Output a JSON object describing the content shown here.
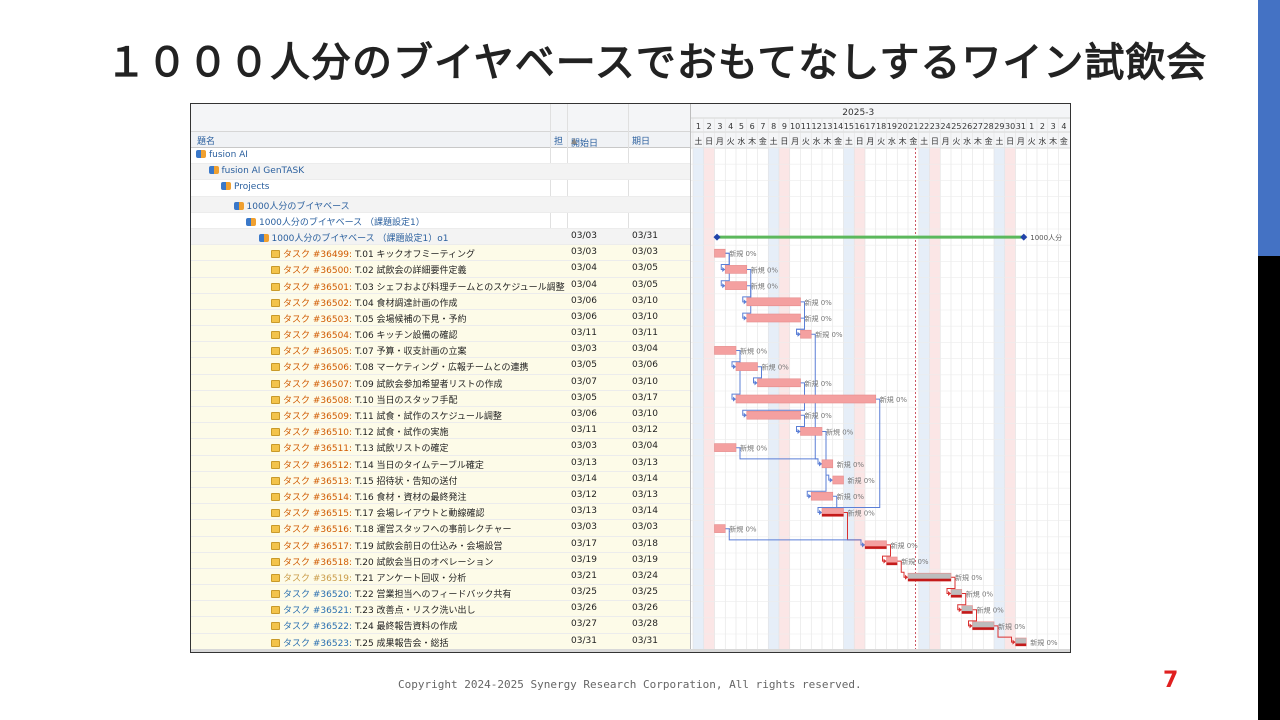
{
  "slide": {
    "title": "１０００人分のブイヤベースでおもてなしするワイン試飲会",
    "copyright": "Copyright 2024-2025 Synergy Research Corporation, All rights reserved.",
    "page_number": "7",
    "accent_color": "#4472c4"
  },
  "gantt": {
    "month_label": "2025-3",
    "columns": {
      "name": "題名",
      "assignee": "担",
      "start": "開始日",
      "end": "期日"
    },
    "day_numbers": [
      "1",
      "2",
      "3",
      "4",
      "5",
      "6",
      "7",
      "8",
      "9",
      "10",
      "11",
      "12",
      "13",
      "14",
      "15",
      "16",
      "17",
      "18",
      "19",
      "20",
      "21",
      "22",
      "23",
      "24",
      "25",
      "26",
      "27",
      "28",
      "29",
      "30",
      "31",
      "1",
      "2",
      "3",
      "4"
    ],
    "weekdays": [
      "土",
      "日",
      "月",
      "火",
      "水",
      "木",
      "金",
      "土",
      "日",
      "月",
      "火",
      "水",
      "木",
      "金",
      "土",
      "日",
      "月",
      "火",
      "水",
      "木",
      "金",
      "土",
      "日",
      "月",
      "火",
      "水",
      "木",
      "金",
      "土",
      "日",
      "月",
      "火",
      "水",
      "木",
      "金"
    ],
    "milestone_label": "1000人分",
    "progress_label": "新規 0%",
    "hierarchy": [
      {
        "name": "fusion AI",
        "level": 0
      },
      {
        "name": "fusion AI GenTASK",
        "level": 1
      },
      {
        "name": "Projects",
        "level": 2
      },
      {
        "name": "1000人分のブイヤベース",
        "level": 3
      },
      {
        "name": "1000人分のブイヤベース （課題設定1）",
        "level": 4
      },
      {
        "name": "1000人分のブイヤベース （課題設定1）o1",
        "level": 5,
        "start": "03/03",
        "end": "03/31"
      }
    ],
    "tasks": [
      {
        "id": "タスク #36499:",
        "title": "T.01 キックオフミーティング",
        "start": "03/03",
        "end": "03/03",
        "s": 3,
        "e": 3
      },
      {
        "id": "タスク #36500:",
        "title": "T.02 試飲会の詳細要件定義",
        "start": "03/04",
        "end": "03/05",
        "s": 4,
        "e": 5
      },
      {
        "id": "タスク #36501:",
        "title": "T.03 シェフおよび料理チームとのスケジュール調整",
        "start": "03/04",
        "end": "03/05",
        "s": 4,
        "e": 5
      },
      {
        "id": "タスク #36502:",
        "title": "T.04 食材調達計画の作成",
        "start": "03/06",
        "end": "03/10",
        "s": 6,
        "e": 10
      },
      {
        "id": "タスク #36503:",
        "title": "T.05 会場候補の下見・予約",
        "start": "03/06",
        "end": "03/10",
        "s": 6,
        "e": 10
      },
      {
        "id": "タスク #36504:",
        "title": "T.06 キッチン設備の確認",
        "start": "03/11",
        "end": "03/11",
        "s": 11,
        "e": 11
      },
      {
        "id": "タスク #36505:",
        "title": "T.07 予算・収支計画の立案",
        "start": "03/03",
        "end": "03/04",
        "s": 3,
        "e": 4
      },
      {
        "id": "タスク #36506:",
        "title": "T.08 マーケティング・広報チームとの連携",
        "start": "03/05",
        "end": "03/06",
        "s": 5,
        "e": 6
      },
      {
        "id": "タスク #36507:",
        "title": "T.09 試飲会参加希望者リストの作成",
        "start": "03/07",
        "end": "03/10",
        "s": 7,
        "e": 10
      },
      {
        "id": "タスク #36508:",
        "title": "T.10 当日のスタッフ手配",
        "start": "03/05",
        "end": "03/17",
        "s": 5,
        "e": 17
      },
      {
        "id": "タスク #36509:",
        "title": "T.11 試食・試作のスケジュール調整",
        "start": "03/06",
        "end": "03/10",
        "s": 6,
        "e": 10
      },
      {
        "id": "タスク #36510:",
        "title": "T.12 試食・試作の実施",
        "start": "03/11",
        "end": "03/12",
        "s": 11,
        "e": 12
      },
      {
        "id": "タスク #36511:",
        "title": "T.13 試飲リストの確定",
        "start": "03/03",
        "end": "03/04",
        "s": 3,
        "e": 4
      },
      {
        "id": "タスク #36512:",
        "title": "T.14 当日のタイムテーブル確定",
        "start": "03/13",
        "end": "03/13",
        "s": 13,
        "e": 13
      },
      {
        "id": "タスク #36513:",
        "title": "T.15 招待状・告知の送付",
        "start": "03/14",
        "end": "03/14",
        "s": 14,
        "e": 14
      },
      {
        "id": "タスク #36514:",
        "title": "T.16 食材・資材の最終発注",
        "start": "03/12",
        "end": "03/13",
        "s": 12,
        "e": 13
      },
      {
        "id": "タスク #36515:",
        "title": "T.17 会場レイアウトと動線確認",
        "start": "03/13",
        "end": "03/14",
        "s": 13,
        "e": 14,
        "critical": true
      },
      {
        "id": "タスク #36516:",
        "title": "T.18 運営スタッフへの事前レクチャー",
        "start": "03/03",
        "end": "03/03",
        "s": 3,
        "e": 3
      },
      {
        "id": "タスク #36517:",
        "title": "T.19 試飲会前日の仕込み・会場設営",
        "start": "03/17",
        "end": "03/18",
        "s": 17,
        "e": 18,
        "critical": true
      },
      {
        "id": "タスク #36518:",
        "title": "T.20 試飲会当日のオペレーション",
        "start": "03/19",
        "end": "03/19",
        "s": 19,
        "e": 19,
        "critical": true
      },
      {
        "id": "タスク #36519:",
        "title": "T.21 アンケート回収・分析",
        "start": "03/21",
        "end": "03/24",
        "s": 21,
        "e": 24,
        "critical": true,
        "status": "done"
      },
      {
        "id": "タスク #36520:",
        "title": "T.22 営業担当へのフィードバック共有",
        "start": "03/25",
        "end": "03/25",
        "s": 25,
        "e": 25,
        "critical": true,
        "status": "blue"
      },
      {
        "id": "タスク #36521:",
        "title": "T.23 改善点・リスク洗い出し",
        "start": "03/26",
        "end": "03/26",
        "s": 26,
        "e": 26,
        "critical": true,
        "status": "blue"
      },
      {
        "id": "タスク #36522:",
        "title": "T.24 最終報告資料の作成",
        "start": "03/27",
        "end": "03/28",
        "s": 27,
        "e": 28,
        "critical": true,
        "status": "blue"
      },
      {
        "id": "タスク #36523:",
        "title": "T.25 成果報告会・総括",
        "start": "03/31",
        "end": "03/31",
        "s": 31,
        "e": 31,
        "critical": true,
        "status": "blue"
      }
    ]
  }
}
